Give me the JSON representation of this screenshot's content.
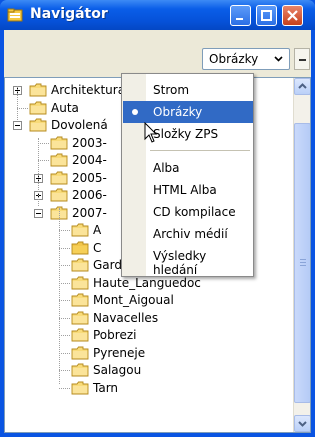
{
  "window": {
    "title": "Navigátor"
  },
  "toolbar": {
    "view_value": "Obrázky"
  },
  "tree": {
    "nodes": [
      {
        "label": "Architektura",
        "level": 0,
        "expander": "plus"
      },
      {
        "label": "Auta",
        "level": 0,
        "expander": "none"
      },
      {
        "label": "Dovolená",
        "level": 0,
        "expander": "minus"
      },
      {
        "label": "2003-",
        "level": 1,
        "expander": "none"
      },
      {
        "label": "2004-",
        "level": 1,
        "expander": "none"
      },
      {
        "label": "2005-",
        "level": 1,
        "expander": "plus"
      },
      {
        "label": "2006-",
        "level": 1,
        "expander": "plus"
      },
      {
        "label": "2007-",
        "level": 1,
        "expander": "minus"
      },
      {
        "label": "A",
        "level": 2,
        "expander": "none"
      },
      {
        "label": "C",
        "level": 2,
        "expander": "none",
        "selected": true
      },
      {
        "label": "Gard",
        "level": 2,
        "expander": "none"
      },
      {
        "label": "Haute_Languedoc",
        "level": 2,
        "expander": "none"
      },
      {
        "label": "Mont_Aigoual",
        "level": 2,
        "expander": "none"
      },
      {
        "label": "Navacelles",
        "level": 2,
        "expander": "none"
      },
      {
        "label": "Pobrezi",
        "level": 2,
        "expander": "none"
      },
      {
        "label": "Pyreneje",
        "level": 2,
        "expander": "none"
      },
      {
        "label": "Salagou",
        "level": 2,
        "expander": "none"
      },
      {
        "label": "Tarn",
        "level": 2,
        "expander": "none"
      }
    ]
  },
  "menu": {
    "items": [
      {
        "label": "Strom"
      },
      {
        "label": "Obrázky",
        "selected": true
      },
      {
        "label": "Složky ZPS"
      },
      {
        "label": "Alba"
      },
      {
        "label": "HTML Alba"
      },
      {
        "label": "CD kompilace"
      },
      {
        "label": "Archiv médií"
      },
      {
        "label": "Výsledky hledání"
      }
    ]
  },
  "colors": {
    "title_bar": "#0a5ee8",
    "menu_highlight": "#316ac5",
    "folder": "#f5d36b"
  }
}
